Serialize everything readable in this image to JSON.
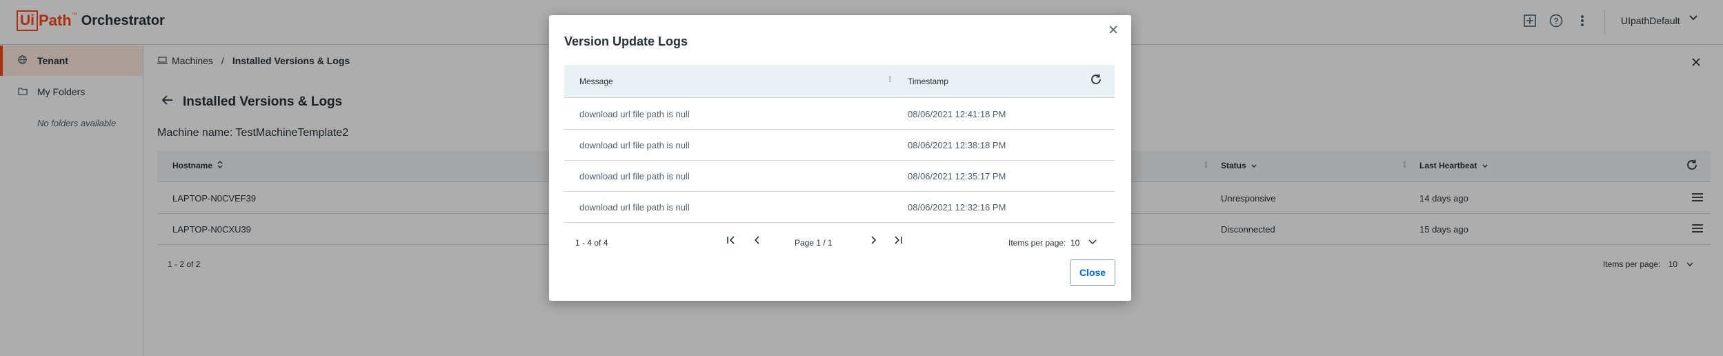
{
  "header": {
    "logo_ui": "Ui",
    "logo_path": "Path",
    "logo_tm": "™",
    "product": "Orchestrator",
    "user": "UIpathDefault"
  },
  "sidebar": {
    "items": [
      {
        "label": "Tenant",
        "icon": "globe-icon"
      },
      {
        "label": "My Folders",
        "icon": "folder-icon"
      }
    ],
    "empty_text": "No folders available"
  },
  "breadcrumb": {
    "parent": "Machines",
    "separator": "/",
    "current": "Installed Versions & Logs"
  },
  "page": {
    "title": "Installed Versions & Logs",
    "machine_name": "Machine name: TestMachineTemplate2"
  },
  "grid": {
    "columns": {
      "hostname": "Hostname",
      "status": "Status",
      "last_heartbeat": "Last Heartbeat"
    },
    "rows": [
      {
        "hostname": "LAPTOP-N0CVEF39",
        "status": "Unresponsive",
        "last_heartbeat": "14 days ago"
      },
      {
        "hostname": "LAPTOP-N0CXU39",
        "status": "Disconnected",
        "last_heartbeat": "15 days ago"
      }
    ],
    "range": "1 - 2 of 2",
    "items_per_page_label": "Items per page:",
    "items_per_page": "10"
  },
  "modal": {
    "title": "Version Update Logs",
    "columns": {
      "message": "Message",
      "timestamp": "Timestamp"
    },
    "rows": [
      {
        "message": "download url file path is null",
        "timestamp": "08/06/2021 12:41:18 PM"
      },
      {
        "message": "download url file path is null",
        "timestamp": "08/06/2021 12:38:18 PM"
      },
      {
        "message": "download url file path is null",
        "timestamp": "08/06/2021 12:35:17 PM"
      },
      {
        "message": "download url file path is null",
        "timestamp": "08/06/2021 12:32:16 PM"
      }
    ],
    "pager": {
      "range": "1 - 4 of 4",
      "page_label": "Page 1 / 1",
      "items_per_page_label": "Items per page:",
      "items_per_page": "10"
    },
    "close_label": "Close"
  },
  "colors": {
    "brand": "#fa4616",
    "link": "#0067df"
  }
}
